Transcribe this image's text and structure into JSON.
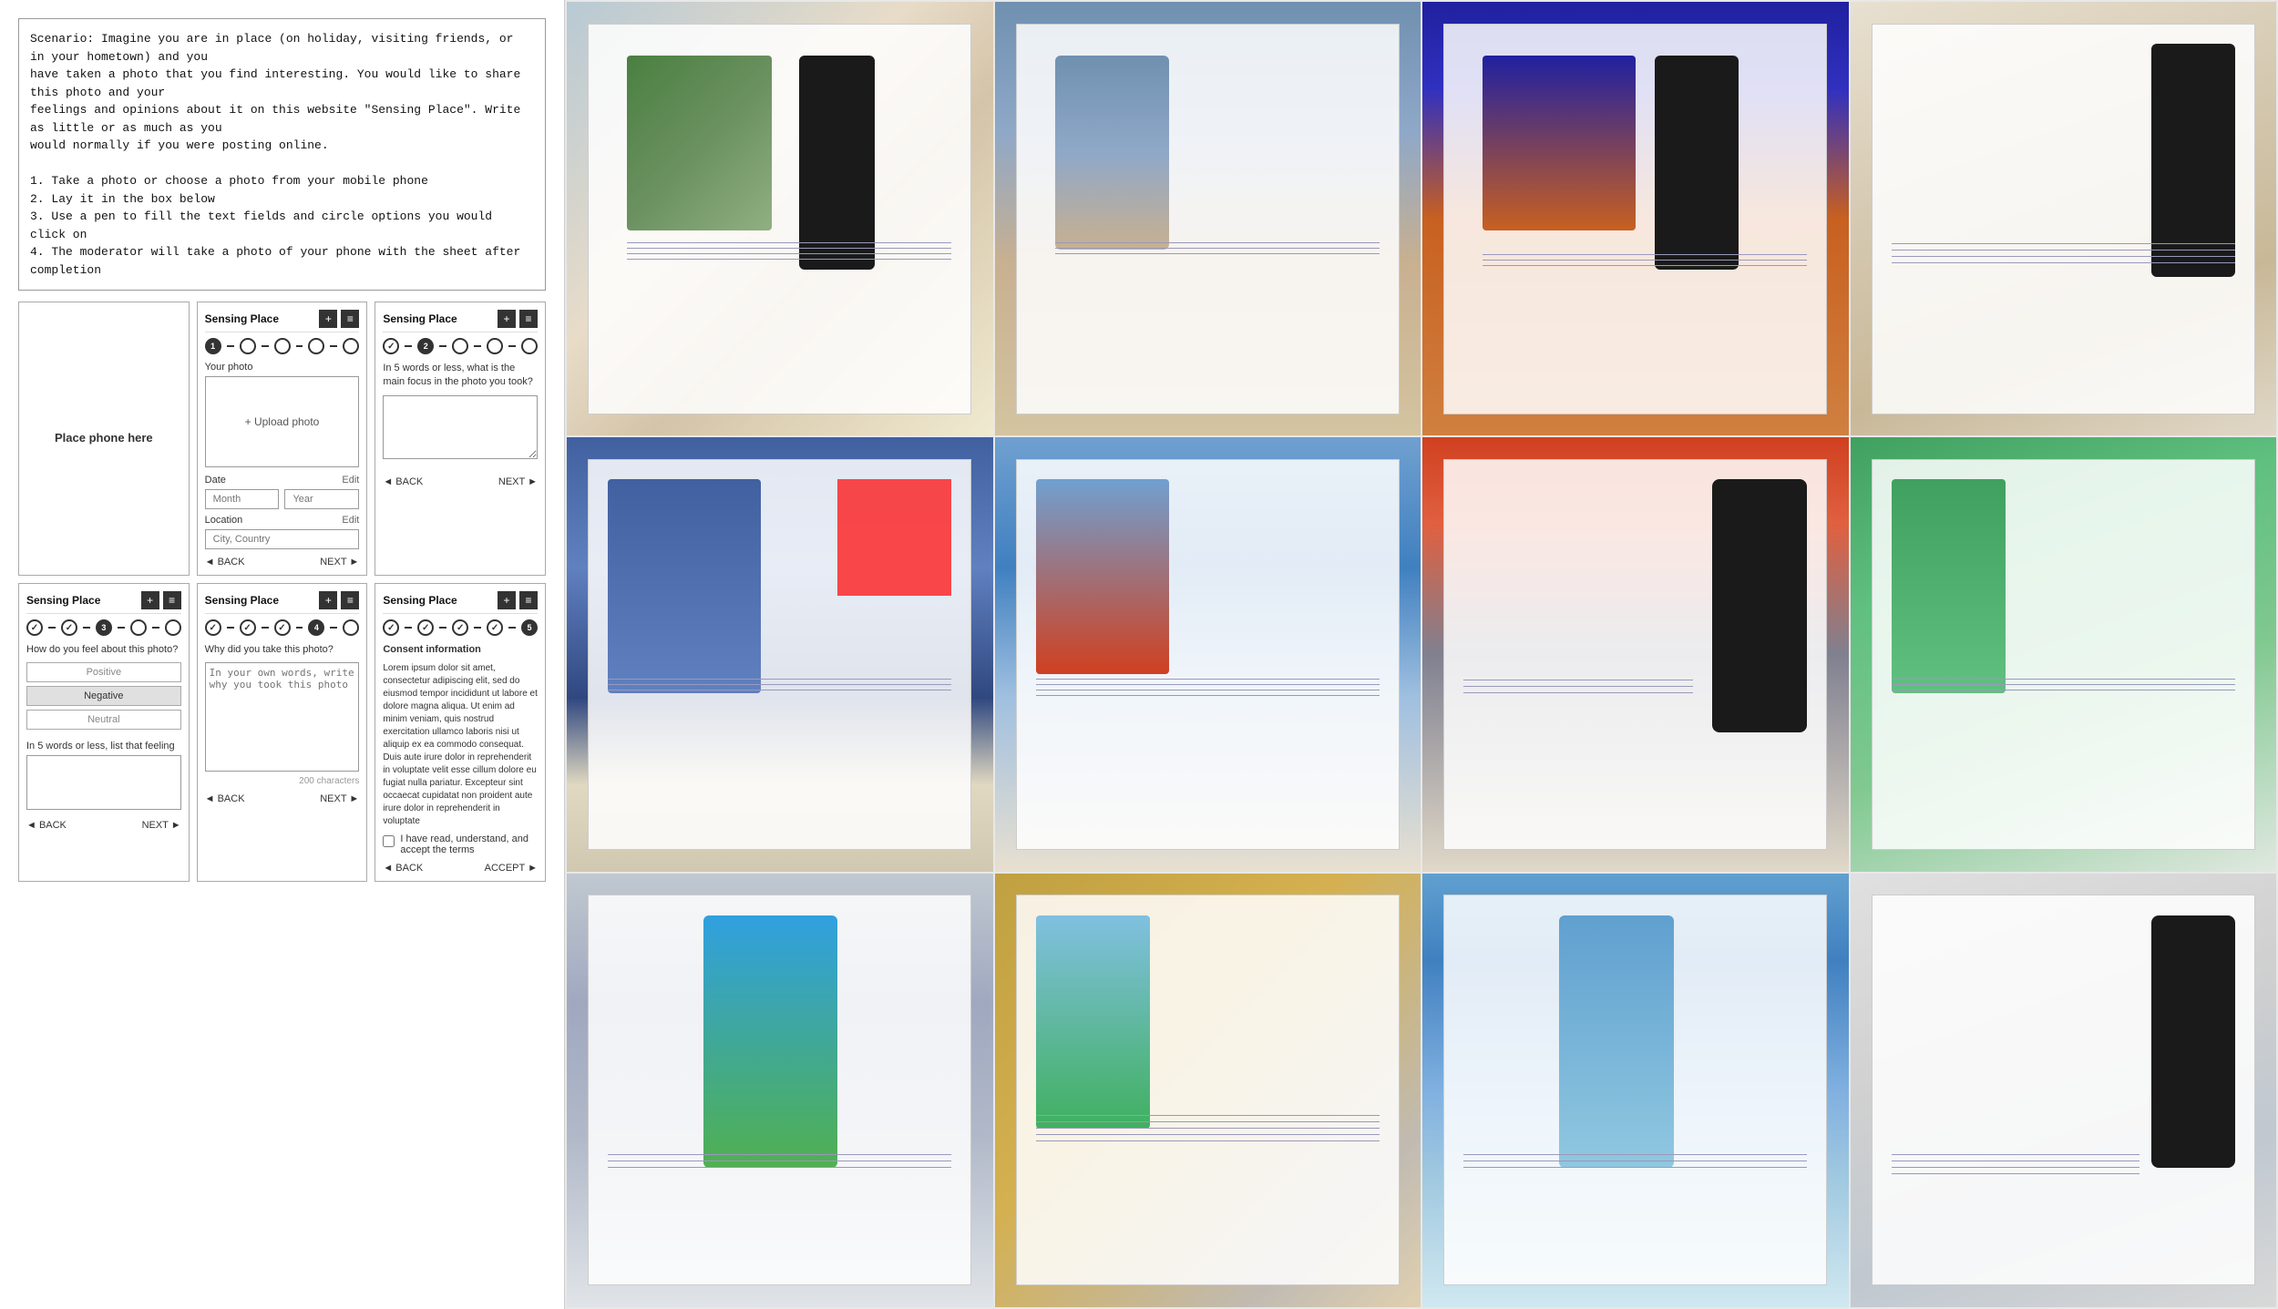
{
  "scenario": {
    "text": "Scenario: Imagine you are in place (on holiday, visiting friends, or in your hometown) and you\nhave taken a photo that you find interesting. You would like to share this photo and your\nfeelings and opinions about it on this website \"Sensing Place\". Write as little or as much as you\nwould normally if you were posting online.\n\n1. Take a photo or choose a photo from your mobile phone\n2. Lay it in the box below\n3. Use a pen to fill the text fields and circle options you would click on\n4. The moderator will take a photo of your phone with the sheet after completion"
  },
  "card0": {
    "label": "Place phone here"
  },
  "card1": {
    "title": "Sensing Place",
    "upload_label": "+ Upload photo",
    "date_label": "Date",
    "date_edit": "Edit",
    "month_placeholder": "Month",
    "year_placeholder": "Year",
    "location_label": "Location",
    "location_edit": "Edit",
    "city_placeholder": "City, Country",
    "back_label": "◄ BACK",
    "next_label": "NEXT ►",
    "your_photo_label": "Your photo"
  },
  "card2": {
    "title": "Sensing Place",
    "question": "In 5 words or less, what is the main focus in the photo you took?",
    "back_label": "◄ BACK",
    "next_label": "NEXT ►"
  },
  "card3": {
    "title": "Sensing Place",
    "question": "How do you feel about this photo?",
    "positive_label": "Positive",
    "negative_label": "Negative",
    "neutral_label": "Neutral",
    "sub_question": "In 5 words or less, list that feeling",
    "char_hint": "",
    "back_label": "◄ BACK",
    "next_label": "NEXT ►"
  },
  "card4": {
    "title": "Sensing Place",
    "question": "Why did you take this photo?",
    "placeholder": "In your own words, write why you took this photo",
    "char_count": "200 characters",
    "back_label": "◄ BACK",
    "next_label": "NEXT ►"
  },
  "card5": {
    "title": "Sensing Place",
    "consent_heading": "Consent information",
    "consent_text": "Lorem ipsum dolor sit amet, consectetur adipiscing elit, sed do eiusmod tempor incididunt ut labore et dolore magna aliqua. Ut enim ad minim veniam, quis nostrud exercitation ullamco laboris nisi ut aliquip ex ea commodo consequat. Duis aute irure dolor in reprehenderit in voluptate velit esse cillum dolore eu fugiat nulla pariatur. Excepteur sint occaecat cupidatat non proident aute irure dolor in reprehenderit in voluptate",
    "checkbox_label": "I have read, understand, and accept the terms",
    "back_label": "◄ BACK",
    "accept_label": "ACCEPT ►"
  },
  "photos": [
    {
      "id": 1,
      "class": "p1"
    },
    {
      "id": 2,
      "class": "p2"
    },
    {
      "id": 3,
      "class": "p3"
    },
    {
      "id": 4,
      "class": "p4"
    },
    {
      "id": 5,
      "class": "p5"
    },
    {
      "id": 6,
      "class": "p6"
    },
    {
      "id": 7,
      "class": "p7"
    },
    {
      "id": 8,
      "class": "p8"
    },
    {
      "id": 9,
      "class": "p9"
    },
    {
      "id": 10,
      "class": "p10"
    },
    {
      "id": 11,
      "class": "p11"
    },
    {
      "id": 12,
      "class": "p12"
    }
  ]
}
